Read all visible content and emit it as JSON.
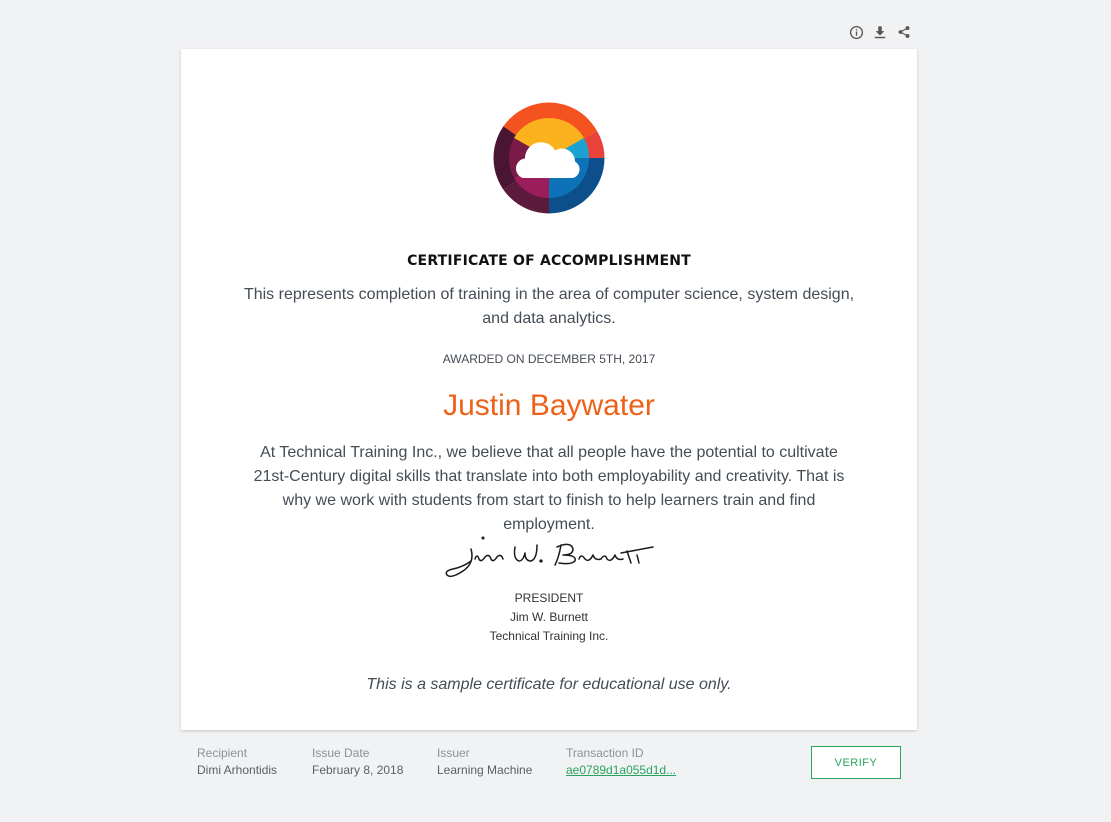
{
  "toolbar": {
    "icons": [
      "info-icon",
      "download-icon",
      "share-icon"
    ]
  },
  "certificate": {
    "title": "CERTIFICATE OF ACCOMPLISHMENT",
    "description": "This represents completion of training in the area of computer science, system design, and data analytics.",
    "awarded": "AWARDED ON DECEMBER 5TH, 2017",
    "recipient_name": "Justin Baywater",
    "body": "At Technical Training Inc., we believe that all people have the potential to cultivate 21st-Century digital skills that translate into both employability and creativity. That is why we work with students from start to finish to help learners train and find employment.",
    "signature_text": "Jim W. Burnett",
    "signer_title": "PRESIDENT",
    "signer_name": "Jim W. Burnett",
    "signer_org": "Technical Training Inc.",
    "sample_note": "This is a sample certificate for educational use only.",
    "colors": {
      "name": "#ef6118",
      "text": "#444c55"
    }
  },
  "meta": {
    "recipient_label": "Recipient",
    "recipient_value": "Dimi Arhontidis",
    "issue_date_label": "Issue Date",
    "issue_date_value": "February 8, 2018",
    "issuer_label": "Issuer",
    "issuer_value": "Learning Machine",
    "transaction_label": "Transaction ID",
    "transaction_value": "ae0789d1a055d1d..."
  },
  "verify_label": "VERIFY",
  "colors": {
    "accent": "#2aa35f",
    "background": "#f1f2f4"
  }
}
